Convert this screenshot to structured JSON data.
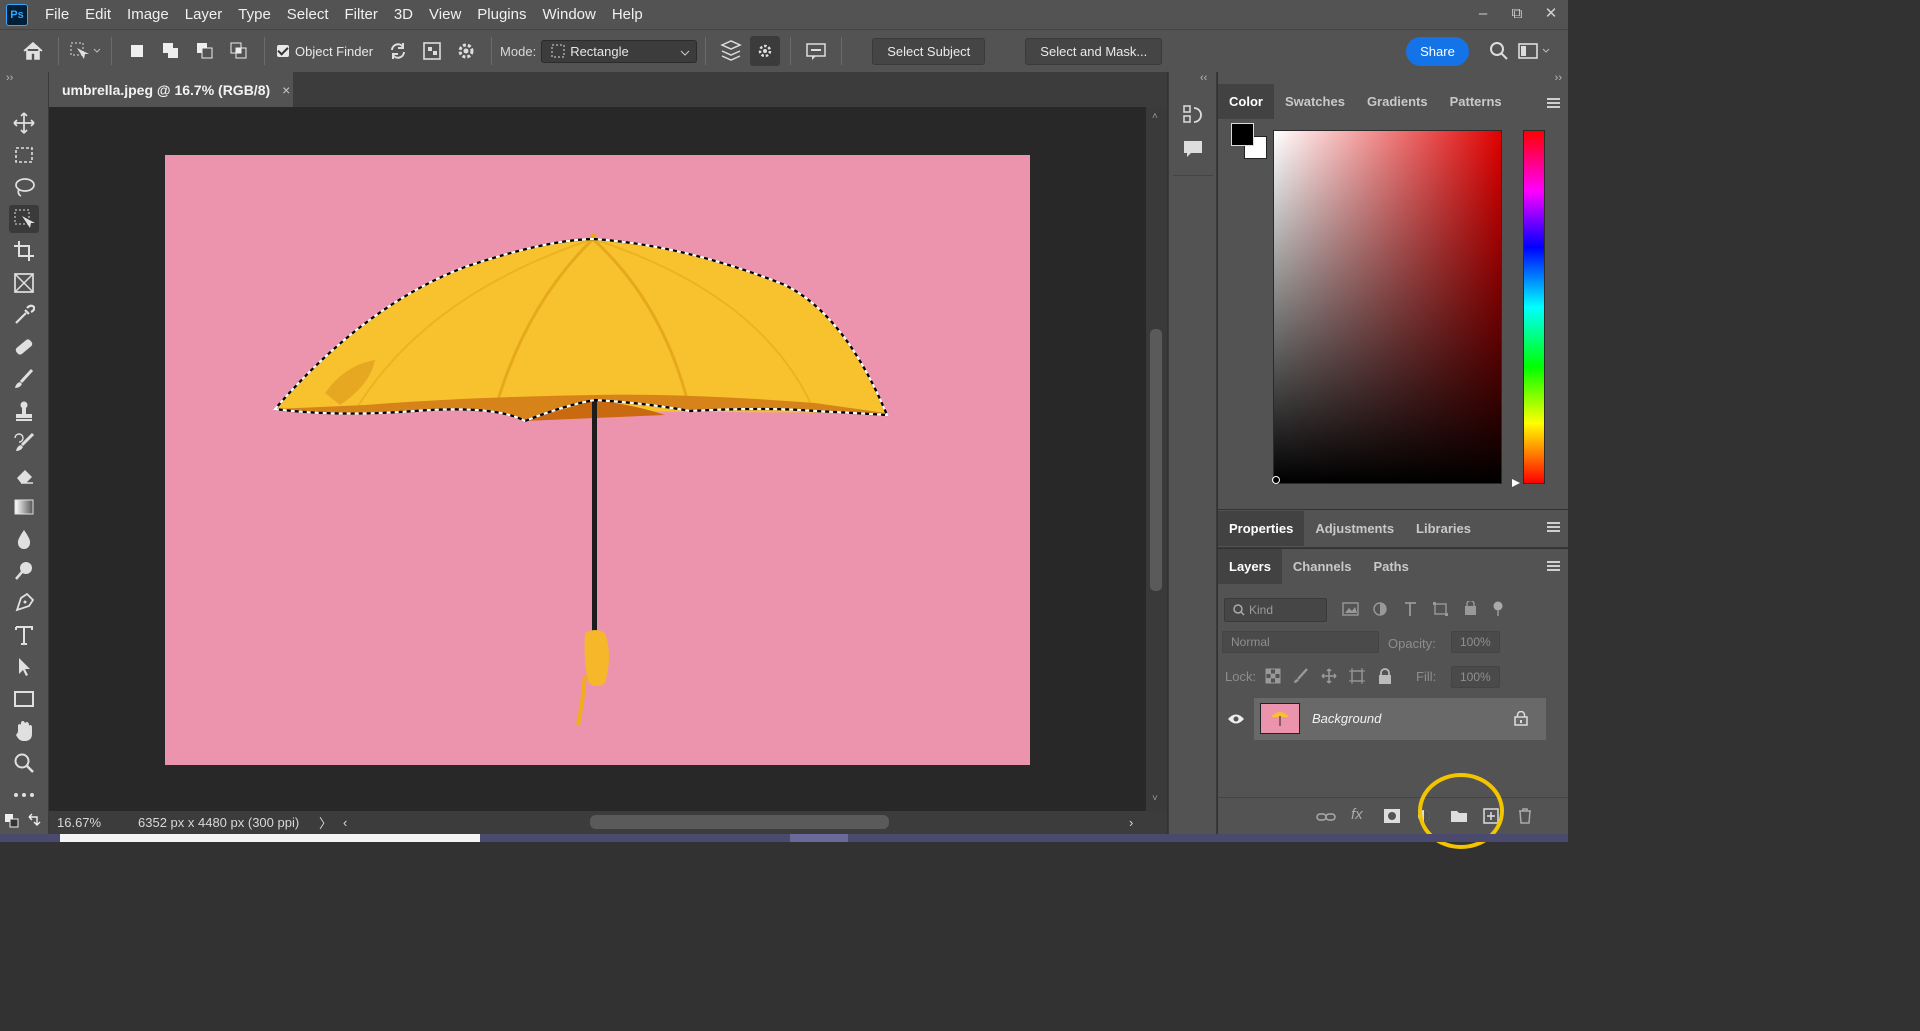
{
  "app": {
    "logo": "Ps"
  },
  "menu": [
    "File",
    "Edit",
    "Image",
    "Layer",
    "Type",
    "Select",
    "Filter",
    "3D",
    "View",
    "Plugins",
    "Window",
    "Help"
  ],
  "window_controls": {
    "minimize": "–",
    "restore": "⧉",
    "close": "✕"
  },
  "options_bar": {
    "object_finder_label": "Object Finder",
    "object_finder_checked": true,
    "mode_label": "Mode:",
    "mode_value": "Rectangle",
    "select_subject": "Select Subject",
    "select_and_mask": "Select and Mask...",
    "share": "Share",
    "accent_color": "#1473e6"
  },
  "tools": [
    "move-tool",
    "marquee-tool",
    "lasso-tool",
    "object-selection-tool",
    "crop-tool",
    "frame-tool",
    "eyedropper-tool",
    "healing-brush-tool",
    "brush-tool",
    "clone-stamp-tool",
    "history-brush-tool",
    "eraser-tool",
    "gradient-tool",
    "blur-tool",
    "dodge-tool",
    "pen-tool",
    "type-tool",
    "path-selection-tool",
    "rectangle-tool",
    "hand-tool",
    "zoom-tool",
    "more-tools"
  ],
  "document": {
    "tab_title": "umbrella.jpeg @ 16.7% (RGB/8)",
    "tab_close": "×",
    "background_color": "#ec94ae",
    "subject_color": "#f8c22e"
  },
  "status": {
    "zoom": "16.67%",
    "doc_info": "6352 px x 4480 px (300 ppi)",
    "arrow": "〉",
    "scroll_left": "‹",
    "scroll_right": "›"
  },
  "panels": {
    "color_tabs": [
      "Color",
      "Swatches",
      "Gradients",
      "Patterns"
    ],
    "properties_tabs": [
      "Properties",
      "Adjustments",
      "Libraries"
    ],
    "layers_tabs": [
      "Layers",
      "Channels",
      "Paths"
    ],
    "foreground_color": "#000000",
    "background_color": "#ffffff",
    "kind_placeholder": "Kind",
    "blend_mode": "Normal",
    "opacity_label": "Opacity:",
    "opacity_value": "100%",
    "lock_label": "Lock:",
    "fill_label": "Fill:",
    "fill_value": "100%",
    "layer_name": "Background"
  },
  "highlight": {
    "color": "#f3c400",
    "target": "new-group-folder-icon"
  }
}
